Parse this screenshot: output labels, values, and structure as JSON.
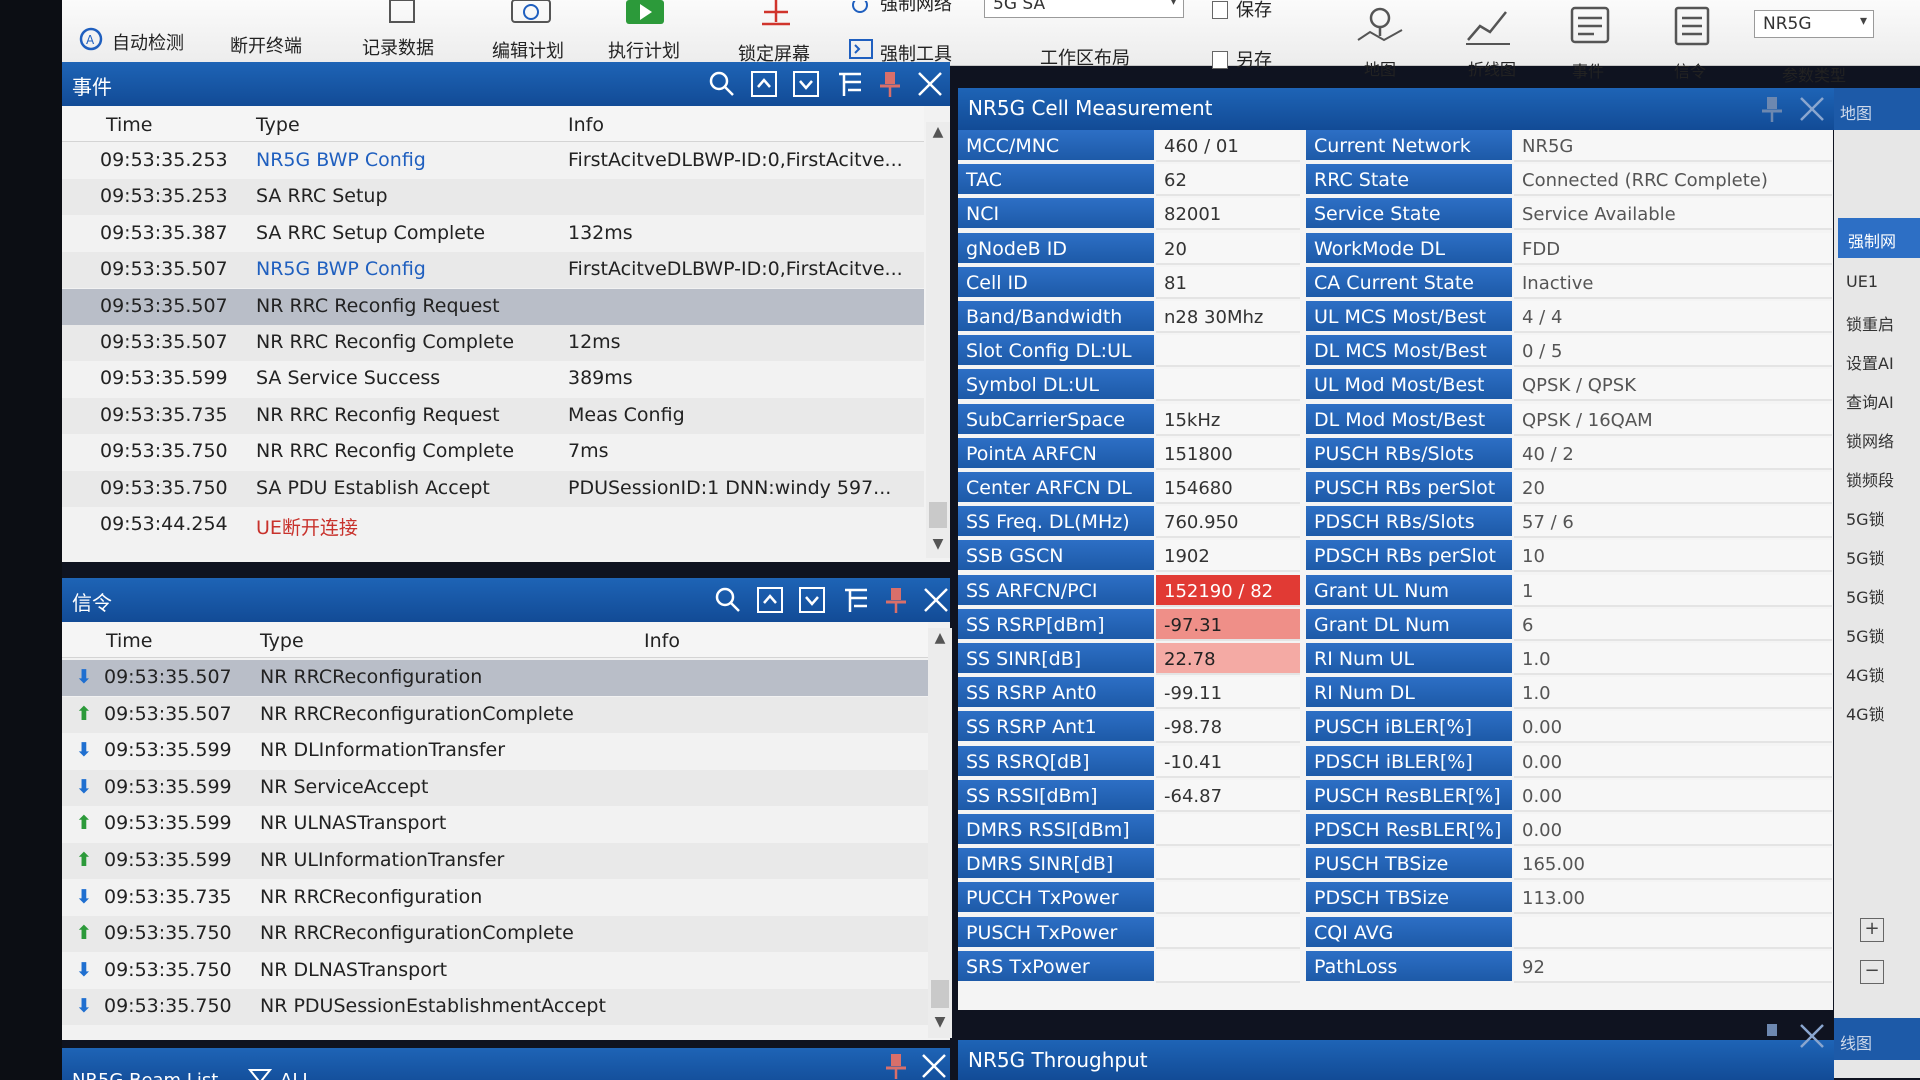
{
  "toolbar": {
    "auto_detect": "自动检测",
    "disconnect_terminal": "断开终端",
    "record_data": "记录数据",
    "edit_plan": "编辑计划",
    "execute_plan": "执行计划",
    "lock_screen": "锁定屏幕",
    "force_network": "强制网络",
    "force_tool": "强制工具",
    "mode_select": "5G SA",
    "workspace_layout": "工作区布局",
    "save": "保存",
    "save_as": "另存",
    "map": "地图",
    "line_chart": "折线图",
    "event": "事件",
    "signaling": "信令",
    "param_type": "参数类型",
    "network_select": "NR5G"
  },
  "events_panel": {
    "title": "事件",
    "columns": [
      "Time",
      "Type",
      "Info"
    ],
    "rows": [
      {
        "time": "09:53:35.253",
        "type": "NR5G BWP Config",
        "info": "FirstAcitveDLBWP-ID:0,FirstAcitve...",
        "style": "blue"
      },
      {
        "time": "09:53:35.253",
        "type": "SA RRC Setup",
        "info": "",
        "style": ""
      },
      {
        "time": "09:53:35.387",
        "type": "SA RRC Setup Complete",
        "info": "132ms",
        "style": ""
      },
      {
        "time": "09:53:35.507",
        "type": "NR5G BWP Config",
        "info": "FirstAcitveDLBWP-ID:0,FirstAcitve...",
        "style": "blue"
      },
      {
        "time": "09:53:35.507",
        "type": "NR RRC Reconfig Request",
        "info": "",
        "style": "selected"
      },
      {
        "time": "09:53:35.507",
        "type": "NR RRC Reconfig Complete",
        "info": "12ms",
        "style": ""
      },
      {
        "time": "09:53:35.599",
        "type": "SA Service Success",
        "info": "389ms",
        "style": ""
      },
      {
        "time": "09:53:35.735",
        "type": "NR RRC Reconfig Request",
        "info": "Meas Config",
        "style": ""
      },
      {
        "time": "09:53:35.750",
        "type": "NR RRC Reconfig Complete",
        "info": "7ms",
        "style": ""
      },
      {
        "time": "09:53:35.750",
        "type": "SA PDU Establish Accept",
        "info": "PDUSessionID:1   DNN:windy   597...",
        "style": ""
      },
      {
        "time": "09:53:44.254",
        "type": "UE断开连接",
        "info": "",
        "style": "red"
      }
    ]
  },
  "signal_panel": {
    "title": "信令",
    "columns": [
      "Time",
      "Type",
      "Info"
    ],
    "rows": [
      {
        "dir": "down",
        "time": "09:53:35.507",
        "type": "NR RRCReconfiguration",
        "info": "",
        "style": "selected"
      },
      {
        "dir": "up",
        "time": "09:53:35.507",
        "type": "NR RRCReconfigurationComplete",
        "info": "",
        "style": ""
      },
      {
        "dir": "down",
        "time": "09:53:35.599",
        "type": "NR DLInformationTransfer",
        "info": "",
        "style": ""
      },
      {
        "dir": "down",
        "time": "09:53:35.599",
        "type": "NR ServiceAccept",
        "info": "",
        "style": ""
      },
      {
        "dir": "up",
        "time": "09:53:35.599",
        "type": "NR ULNASTransport",
        "info": "",
        "style": ""
      },
      {
        "dir": "up",
        "time": "09:53:35.599",
        "type": "NR ULInformationTransfer",
        "info": "",
        "style": ""
      },
      {
        "dir": "down",
        "time": "09:53:35.735",
        "type": "NR RRCReconfiguration",
        "info": "",
        "style": ""
      },
      {
        "dir": "up",
        "time": "09:53:35.750",
        "type": "NR RRCReconfigurationComplete",
        "info": "",
        "style": ""
      },
      {
        "dir": "down",
        "time": "09:53:35.750",
        "type": "NR DLNASTransport",
        "info": "",
        "style": ""
      },
      {
        "dir": "down",
        "time": "09:53:35.750",
        "type": "NR PDUSessionEstablishmentAccept",
        "info": "",
        "style": ""
      }
    ]
  },
  "beam_panel": {
    "title": "NR5G Beam List",
    "filter": "ALL"
  },
  "measurement_panel": {
    "title": "NR5G Cell Measurement",
    "left": [
      {
        "name": "MCC/MNC",
        "value": "460 / 01",
        "hl": ""
      },
      {
        "name": "TAC",
        "value": "62",
        "hl": ""
      },
      {
        "name": "NCI",
        "value": "82001",
        "hl": ""
      },
      {
        "name": "gNodeB ID",
        "value": "20",
        "hl": ""
      },
      {
        "name": "Cell ID",
        "value": "81",
        "hl": ""
      },
      {
        "name": "Band/Bandwidth",
        "value": "n28   30Mhz",
        "hl": ""
      },
      {
        "name": "Slot Config DL:UL",
        "value": "",
        "hl": ""
      },
      {
        "name": "Symbol DL:UL",
        "value": "",
        "hl": ""
      },
      {
        "name": "SubCarrierSpace",
        "value": "15kHz",
        "hl": ""
      },
      {
        "name": "PointA ARFCN",
        "value": "151800",
        "hl": ""
      },
      {
        "name": "Center ARFCN DL",
        "value": "154680",
        "hl": ""
      },
      {
        "name": "SS Freq. DL(MHz)",
        "value": "760.950",
        "hl": ""
      },
      {
        "name": "SSB GSCN",
        "value": "1902",
        "hl": ""
      },
      {
        "name": "SS ARFCN/PCI",
        "value": "152190 / 82",
        "hl": "red"
      },
      {
        "name": "SS RSRP[dBm]",
        "value": "-97.31",
        "hl": "pink"
      },
      {
        "name": "SS SINR[dB]",
        "value": "22.78",
        "hl": "pink2"
      },
      {
        "name": "SS RSRP Ant0",
        "value": "-99.11",
        "hl": ""
      },
      {
        "name": "SS RSRP Ant1",
        "value": "-98.78",
        "hl": ""
      },
      {
        "name": "SS RSRQ[dB]",
        "value": "-10.41",
        "hl": ""
      },
      {
        "name": "SS RSSI[dBm]",
        "value": "-64.87",
        "hl": ""
      },
      {
        "name": "DMRS RSSI[dBm]",
        "value": "",
        "hl": ""
      },
      {
        "name": "DMRS SINR[dB]",
        "value": "",
        "hl": ""
      },
      {
        "name": "PUCCH TxPower",
        "value": "",
        "hl": ""
      },
      {
        "name": "PUSCH TxPower",
        "value": "",
        "hl": ""
      },
      {
        "name": "SRS TxPower",
        "value": "",
        "hl": ""
      }
    ],
    "right": [
      {
        "name": "Current Network",
        "value": "NR5G"
      },
      {
        "name": "RRC State",
        "value": "Connected (RRC Complete)"
      },
      {
        "name": "Service State",
        "value": "Service Available"
      },
      {
        "name": "WorkMode DL",
        "value": "FDD"
      },
      {
        "name": "CA Current State",
        "value": "Inactive"
      },
      {
        "name": "UL MCS Most/Best",
        "value": "4 / 4"
      },
      {
        "name": "DL MCS Most/Best",
        "value": "0 / 5"
      },
      {
        "name": "UL Mod Most/Best",
        "value": "QPSK / QPSK"
      },
      {
        "name": "DL Mod Most/Best",
        "value": "QPSK / 16QAM"
      },
      {
        "name": "PUSCH RBs/Slots",
        "value": "40 / 2"
      },
      {
        "name": "PUSCH RBs perSlot",
        "value": "20"
      },
      {
        "name": "PDSCH RBs/Slots",
        "value": "57 / 6"
      },
      {
        "name": "PDSCH RBs perSlot",
        "value": "10"
      },
      {
        "name": "Grant UL Num",
        "value": "1"
      },
      {
        "name": "Grant DL Num",
        "value": "6"
      },
      {
        "name": "RI Num UL",
        "value": "1.0"
      },
      {
        "name": "RI Num DL",
        "value": "1.0"
      },
      {
        "name": "PUSCH iBLER[%]",
        "value": "0.00"
      },
      {
        "name": "PDSCH iBLER[%]",
        "value": "0.00"
      },
      {
        "name": "PUSCH ResBLER[%]",
        "value": "0.00"
      },
      {
        "name": "PDSCH ResBLER[%]",
        "value": "0.00"
      },
      {
        "name": "PUSCH TBSize",
        "value": "165.00"
      },
      {
        "name": "PDSCH TBSize",
        "value": "113.00"
      },
      {
        "name": "CQI AVG",
        "value": ""
      },
      {
        "name": "PathLoss",
        "value": "92"
      }
    ]
  },
  "throughput_panel": {
    "title": "NR5G Throughput"
  },
  "right_strip": {
    "map_label": "地图",
    "chart_label": "线图",
    "tab_label": "强制网",
    "items": [
      "UE1",
      "锁重启",
      "设置AI",
      "查询AI",
      "锁网络",
      "锁频段",
      "5G锁",
      "5G锁",
      "5G锁",
      "5G锁",
      "4G锁",
      "4G锁"
    ]
  },
  "colors": {
    "panel_blue": "#1e64b6",
    "cell_blue": "#2d6fc5",
    "highlight_red": "#e13a34",
    "highlight_pink": "#ef8f88",
    "row_selected": "#b9bec8"
  }
}
